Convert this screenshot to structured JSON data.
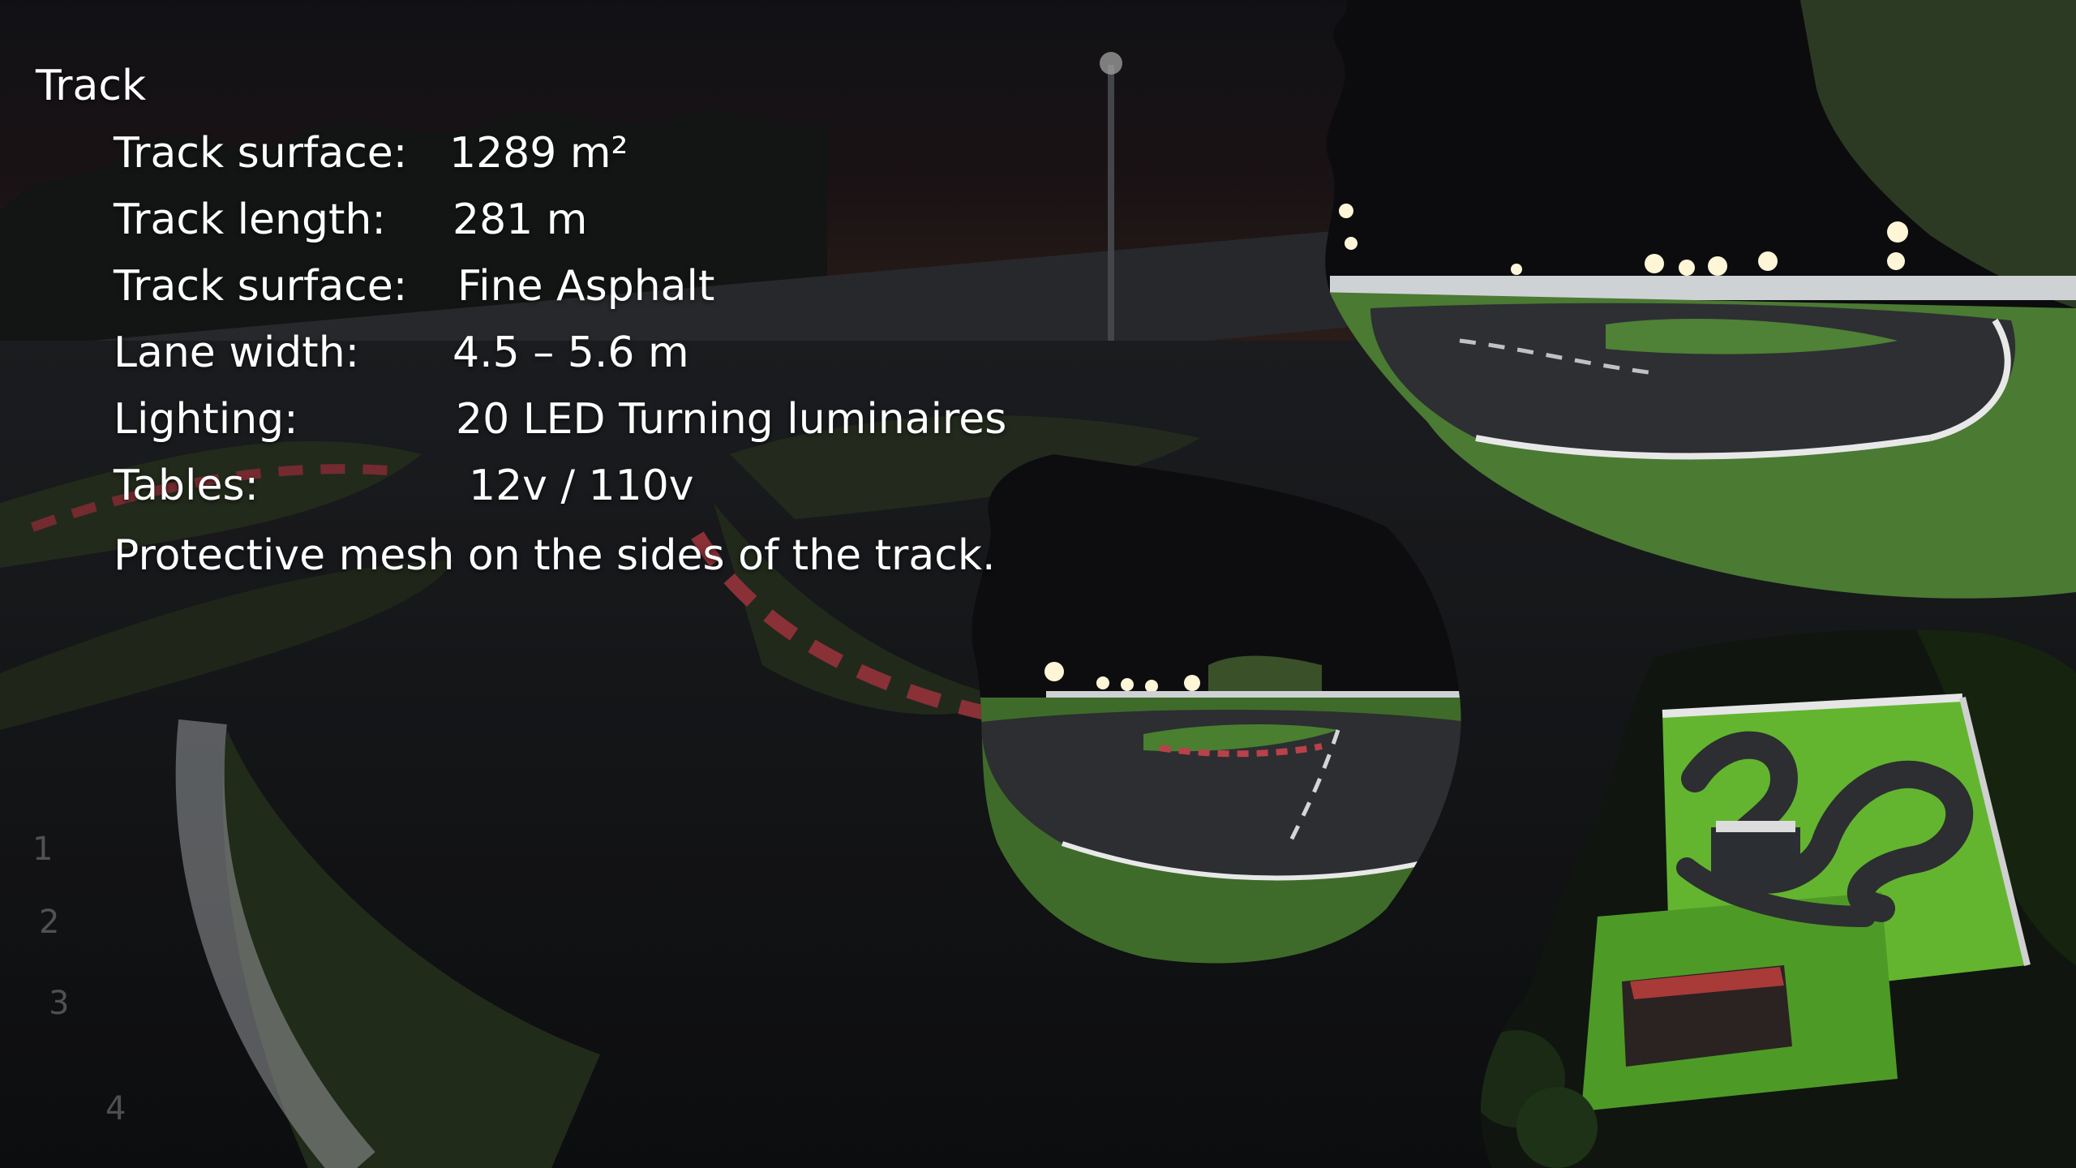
{
  "slide": {
    "heading": "Track",
    "specs": [
      {
        "label": "Track surface:",
        "value": "1289 m²"
      },
      {
        "label": "Track length:",
        "value": "281 m"
      },
      {
        "label": "Track surface:",
        "value": "Fine Asphalt"
      },
      {
        "label": "Lane width:",
        "value": "4.5 – 5.6 m"
      },
      {
        "label": "Lighting:",
        "value": "20 LED Turning luminaires"
      },
      {
        "label": "Tables:",
        "value": "12v / 110v"
      }
    ],
    "note": "Protective mesh on the sides of the track."
  },
  "photos": [
    {
      "icon": "night-track-photo"
    },
    {
      "icon": "track-closeup-photo"
    },
    {
      "icon": "aerial-track-photo"
    }
  ],
  "colors": {
    "asphalt": "#1b1c1f",
    "grass": "#3f6b2a",
    "grass_lit": "#5fae2c",
    "curb_red": "#b8414a",
    "curb_white": "#e8e8e8",
    "light": "#fff6d8"
  }
}
